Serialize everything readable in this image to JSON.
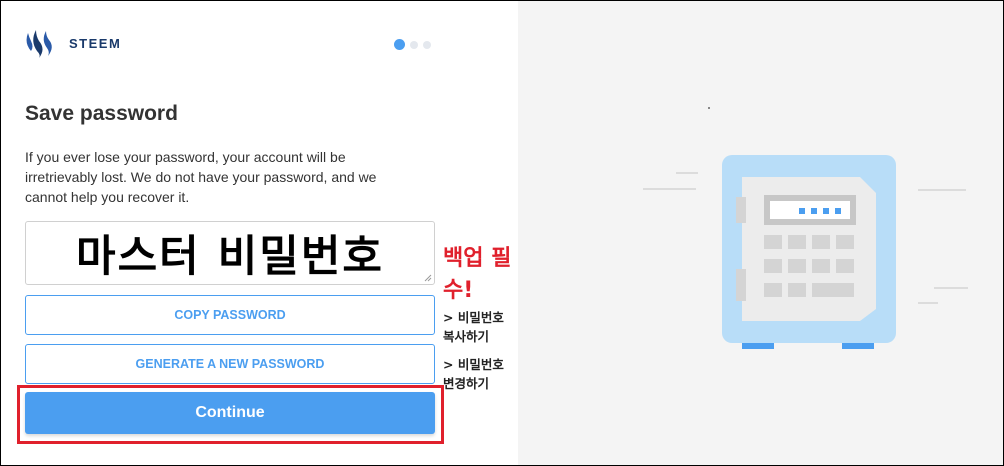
{
  "brand": {
    "name": "STEEM",
    "logo_icon": "steem-logo-icon"
  },
  "progress": {
    "total_steps": 3,
    "current_step": 1
  },
  "page": {
    "title": "Save password",
    "description": "If you ever lose your password, your account will be irretrievably lost. We do not have your password, and we cannot help you recover it."
  },
  "password_field": {
    "value": "마스터 비밀번호"
  },
  "annotations": {
    "required": "백업 필수!",
    "copy_note": "> 비밀번호 복사하기",
    "change_note": "> 비밀번호 변경하기"
  },
  "buttons": {
    "copy": "COPY PASSWORD",
    "generate": "GENERATE A NEW PASSWORD",
    "continue": "Continue"
  },
  "colors": {
    "accent": "#4b9ef0",
    "annotation_red": "#e0202c",
    "brand_navy": "#1a3a6b",
    "illustration_panel": "#f4f4f4"
  },
  "illustration": {
    "icon": "safe-icon"
  }
}
